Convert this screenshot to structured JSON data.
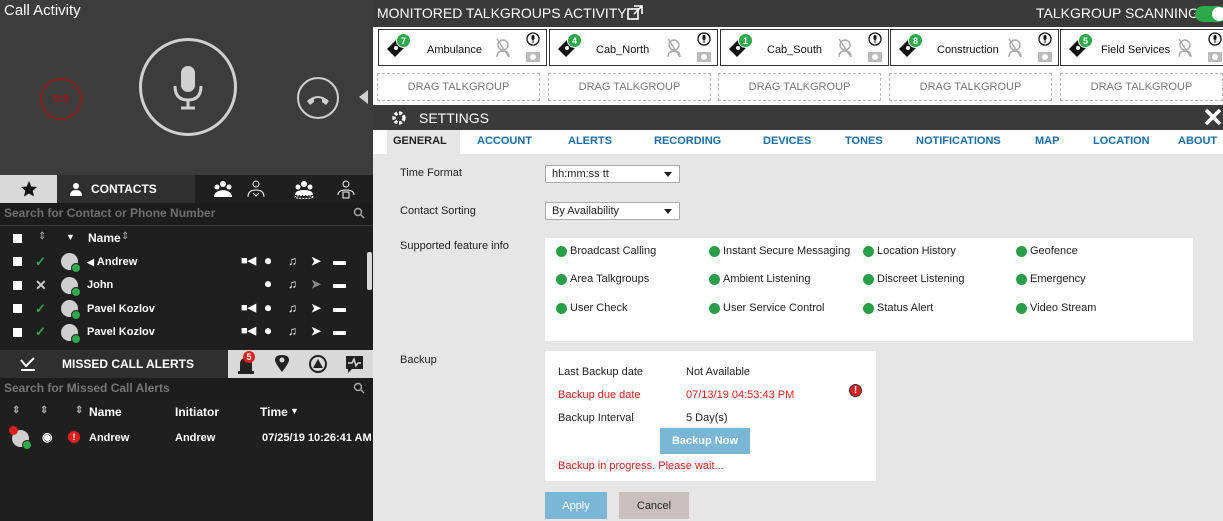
{
  "call_activity": {
    "title": "Call Activity",
    "end_call_label": "0:0"
  },
  "contacts": {
    "tab_label": "CONTACTS",
    "search_placeholder": "Search for Contact or Phone Number",
    "name_header": "Name",
    "rows": [
      {
        "name": "Andrew",
        "flagged": true,
        "status": "ok"
      },
      {
        "name": "John",
        "flagged": false,
        "status": "missed"
      },
      {
        "name": "Pavel Kozlov",
        "flagged": false,
        "status": "ok"
      },
      {
        "name": "Pavel Kozlov",
        "flagged": false,
        "status": "ok"
      }
    ]
  },
  "missed_calls": {
    "tab_label": "MISSED CALL ALERTS",
    "badge": "5",
    "search_placeholder": "Search for Missed Call Alerts",
    "headers": {
      "name": "Name",
      "initiator": "Initiator",
      "time": "Time"
    },
    "rows": [
      {
        "name": "Andrew",
        "initiator": "Andrew",
        "time": "07/25/19 10:26:41 AM"
      }
    ]
  },
  "monitored": {
    "title": "MONITORED TALKGROUPS ACTIVITY",
    "scanning_label": "TALKGROUP SCANNING",
    "scanning_on": true,
    "talkgroups": [
      {
        "count": "7",
        "name": "Ambulance"
      },
      {
        "count": "4",
        "name": "Cab_North"
      },
      {
        "count": "1",
        "name": "Cab_South"
      },
      {
        "count": "8",
        "name": "Construction"
      },
      {
        "count": "5",
        "name": "Field Services"
      }
    ],
    "drag_label": "DRAG TALKGROUP"
  },
  "settings": {
    "title": "SETTINGS",
    "tabs": [
      "GENERAL",
      "ACCOUNT",
      "ALERTS",
      "RECORDING",
      "DEVICES",
      "TONES",
      "NOTIFICATIONS",
      "MAP",
      "LOCATION",
      "ABOUT"
    ],
    "active_tab": "GENERAL",
    "time_format_label": "Time Format",
    "time_format_value": "hh:mm:ss tt",
    "contact_sorting_label": "Contact Sorting",
    "contact_sorting_value": "By Availability",
    "supported_features_label": "Supported feature info",
    "features": [
      "Broadcast Calling",
      "Instant Secure Messaging",
      "Location History",
      "Geofence",
      "Area Talkgroups",
      "Ambient Listening",
      "Discreet Listening",
      "Emergency",
      "User Check",
      "User Service Control",
      "Status Alert",
      "Video Stream"
    ],
    "backup": {
      "label": "Backup",
      "last_date_label": "Last Backup date",
      "last_date_value": "Not Available",
      "due_date_label": "Backup due date",
      "due_date_value": "07/13/19 04:53:43 PM",
      "interval_label": "Backup Interval",
      "interval_value": "5 Day(s)",
      "backup_now": "Backup Now",
      "progress_text": "Backup in progress. Please wait..."
    },
    "apply": "Apply",
    "cancel": "Cancel"
  },
  "colors": {
    "accent_green": "#2da84a",
    "link_blue": "#1a6ca8",
    "alert_red": "#e02020",
    "button_blue": "#7ab7d6"
  }
}
